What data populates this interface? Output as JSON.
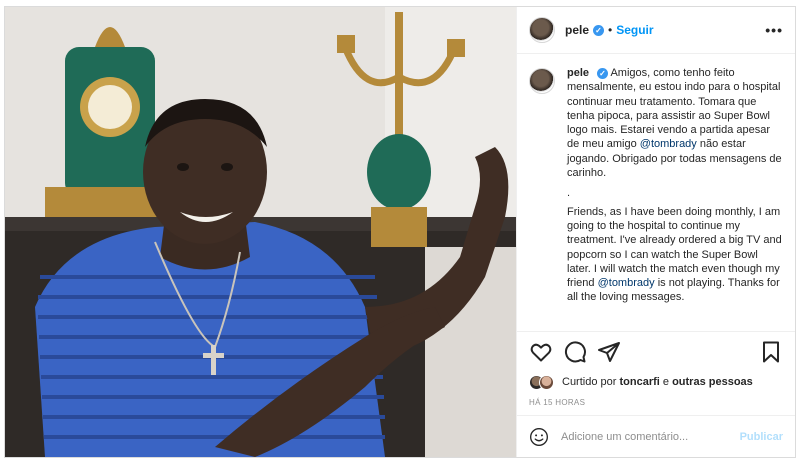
{
  "post": {
    "username": "pele",
    "verified_mark": "✓",
    "follow_label": "Seguir",
    "dot": "•",
    "more_label": "•••",
    "caption": {
      "username": "pele",
      "pt_text": "Amigos, como tenho feito mensalmente, eu estou indo para o hospital continuar meu tratamento. Tomara que tenha pipoca, para assistir ao Super Bowl logo mais. Estarei vendo a partida apesar de meu amigo",
      "pt_mention": "@tombrady",
      "pt_text_end": "não estar jogando. Obrigado por todas mensagens de carinho.",
      "separator": ".",
      "en_text": "Friends, as I have been doing monthly, I am going to the hospital to continue my treatment. I've already ordered a big TV and popcorn so I can watch the Super Bowl later. I will watch the match even though my friend",
      "en_mention": "@tombrady",
      "en_text_end": "is not playing. Thanks for all the loving messages."
    },
    "likes": {
      "prefix": "Curtido por",
      "user": "toncarfi",
      "suffix": "e",
      "others": "outras pessoas"
    },
    "timestamp": "HÁ 15 HORAS",
    "comment": {
      "placeholder": "Adicione um comentário...",
      "publish_label": "Publicar"
    }
  },
  "icons": {
    "like": "heart-icon",
    "comment": "comment-icon",
    "share": "paper-plane-icon",
    "save": "bookmark-icon",
    "emoji": "smiley-icon"
  },
  "colors": {
    "link_blue": "#0095f6",
    "verified_blue": "#3897f0",
    "mention": "#00376b",
    "muted": "#8e8e8e",
    "publish_disabled": "#b2dffc"
  }
}
